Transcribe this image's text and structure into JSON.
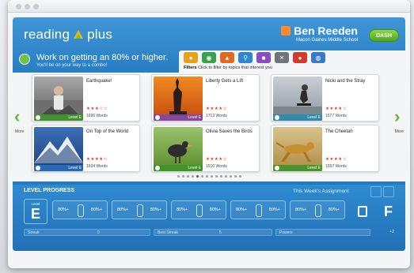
{
  "app": {
    "logo": {
      "reading": "reading",
      "plus": "plus"
    },
    "user": {
      "name": "Ben Reeden",
      "school": "Macon Gaines Middle School"
    },
    "dash_label": "DASH"
  },
  "goal": {
    "headline": "Work on getting an 80% or higher.",
    "sub": "You'll be on your way to a combo!"
  },
  "filters": {
    "label": "Filters",
    "hint": "Click to filter by topics that interest you",
    "icons": [
      "science-icon",
      "earth-icon",
      "history-icon",
      "search-icon",
      "arts-icon",
      "tools-icon",
      "sports-icon",
      "world-icon"
    ]
  },
  "nav": {
    "more_left": "More",
    "more_right": "More"
  },
  "cards": [
    {
      "title": "Earthquake!",
      "words": "1696 Words",
      "level": "Level E",
      "rating": "★★★☆☆"
    },
    {
      "title": "Liberty Gets a Lift",
      "words": "1713 Words",
      "level": "Level E",
      "rating": "★★★★☆"
    },
    {
      "title": "Nicki and the Stray",
      "words": "1577 Words",
      "level": "Level E",
      "rating": "★★★★☆"
    },
    {
      "title": "On Top of the World",
      "words": "1634 Words",
      "level": "Level E",
      "rating": "★★★★☆"
    },
    {
      "title": "Olivia Saves the Birds",
      "words": "1510 Words",
      "level": "Level E",
      "rating": "★★★★☆"
    },
    {
      "title": "The Cheetah",
      "words": "1557 Words",
      "level": "Level E",
      "rating": "★★★★☆"
    }
  ],
  "progress": {
    "title": "LEVEL PROGRESS",
    "assignment": "This Week's Assignment",
    "level_small": "Level",
    "level": "E",
    "next_level": "F",
    "pct_label": "80%+",
    "stats": {
      "streak": "Streak",
      "streak_val": "0",
      "best": "Best Streak",
      "best_val": "5",
      "powers": "Powers",
      "extra": "+2"
    }
  },
  "colors": {
    "brand_blue": "#2a7fc4",
    "accent_green": "#6bb13a",
    "star_red": "#e0402a"
  }
}
